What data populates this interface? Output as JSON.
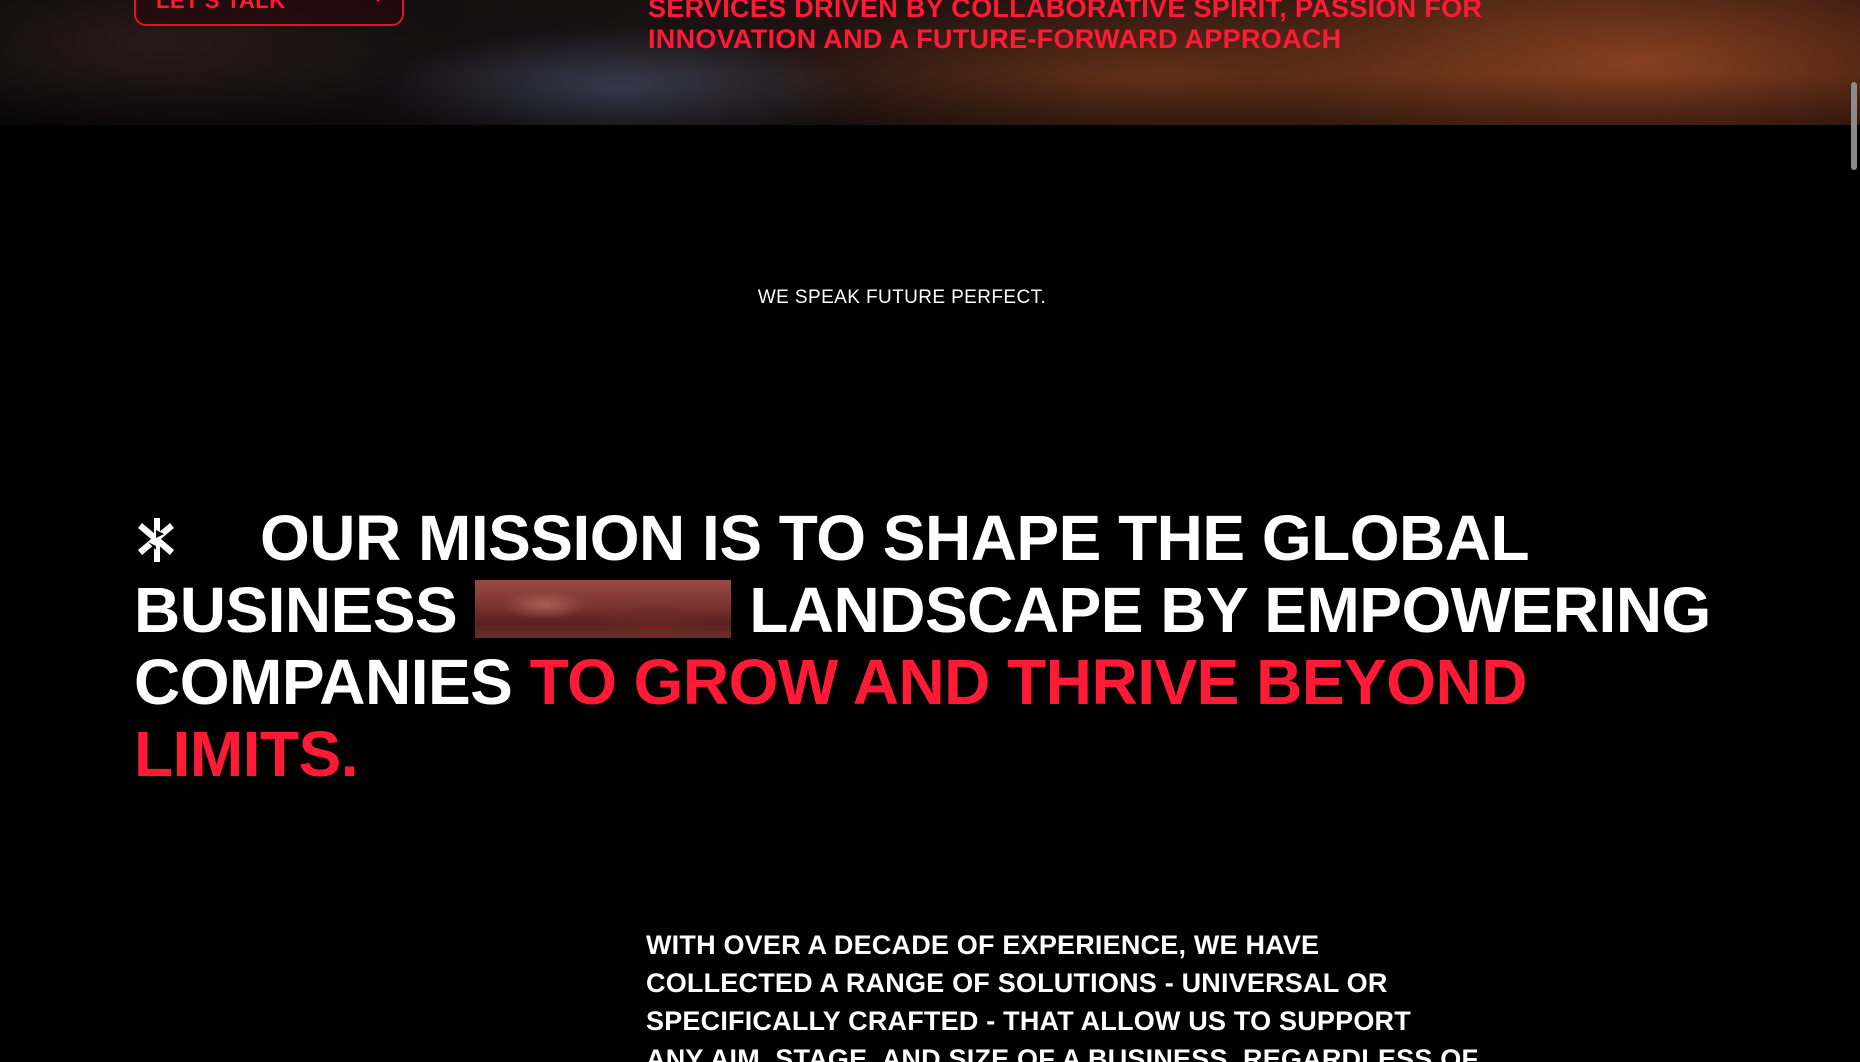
{
  "colors": {
    "background": "#000000",
    "accent": "#ff1a36",
    "text": "#ffffff"
  },
  "hero": {
    "button_label": "LET'S TALK",
    "button_icon": "asterisk-icon",
    "tagline": "SERVICES DRIVEN BY COLLABORATIVE SPIRIT, PASSION FOR INNOVATION AND A FUTURE-FORWARD APPROACH"
  },
  "eyebrow": "WE SPEAK FUTURE PERFECT.",
  "mission": {
    "icon": "asterisk-icon",
    "line1": "OUR MISSION IS TO SHAPE THE GLOBAL",
    "line2_start": "BUSINESS",
    "line2_end": "LANDSCAPE BY EMPOWERING",
    "line3_white": "COMPANIES",
    "line3_red": "TO GROW AND THRIVE BEYOND",
    "line4_red": "LIMITS."
  },
  "about": {
    "line1": "WITH OVER A DECADE OF EXPERIENCE, WE HAVE",
    "line2": "COLLECTED A RANGE OF SOLUTIONS - UNIVERSAL OR",
    "line3": "SPECIFICALLY CRAFTED - THAT ALLOW US TO SUPPORT",
    "line4": "ANY AIM, STAGE, AND SIZE OF A BUSINESS, REGARDLESS OF"
  }
}
